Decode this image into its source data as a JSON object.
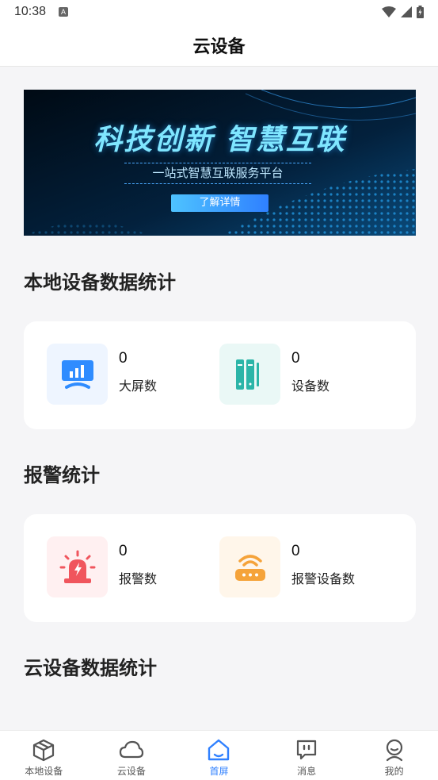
{
  "status_bar": {
    "time": "10:38",
    "notification_glyph": "A"
  },
  "header": {
    "title": "云设备"
  },
  "banner": {
    "headline": "科技创新  智慧互联",
    "subtitle": "一站式智慧互联服务平台",
    "button_label": "了解详情"
  },
  "local_stats": {
    "title": "本地设备数据统计",
    "items": [
      {
        "value": "0",
        "label": "大屏数",
        "icon": "large-screen-icon",
        "color": "#2f8cff"
      },
      {
        "value": "0",
        "label": "设备数",
        "icon": "server-rack-icon",
        "color": "#2bb5a8"
      }
    ]
  },
  "alarm_stats": {
    "title": "报警统计",
    "items": [
      {
        "value": "0",
        "label": "报警数",
        "icon": "alarm-siren-icon",
        "color": "#f0555d"
      },
      {
        "value": "0",
        "label": "报警设备数",
        "icon": "router-icon",
        "color": "#f5a33a"
      }
    ]
  },
  "cloud_stats": {
    "title": "云设备数据统计"
  },
  "tabbar": {
    "active": "home",
    "items": [
      {
        "label": "本地设备",
        "icon": "box-icon"
      },
      {
        "label": "云设备",
        "icon": "cloud-icon"
      },
      {
        "label": "首屏",
        "icon": "home-icon"
      },
      {
        "label": "消息",
        "icon": "message-icon"
      },
      {
        "label": "我的",
        "icon": "user-icon"
      }
    ]
  },
  "colors": {
    "accent": "#2f80ff",
    "background": "#f5f5f7"
  }
}
